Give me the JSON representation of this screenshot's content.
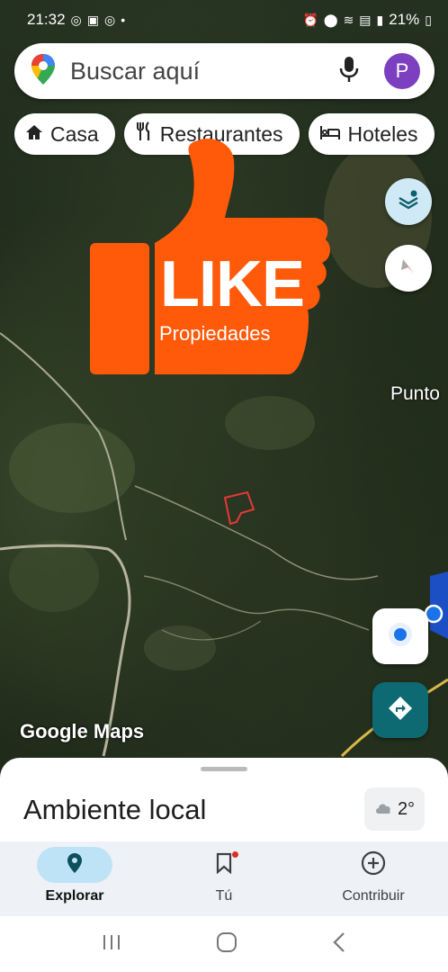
{
  "status": {
    "time": "21:32",
    "battery": "21%"
  },
  "search": {
    "placeholder": "Buscar aquí",
    "avatar_letter": "P"
  },
  "chips": [
    {
      "label": "Casa",
      "icon": "home-icon"
    },
    {
      "label": "Restaurantes",
      "icon": "restaurant-icon"
    },
    {
      "label": "Hoteles",
      "icon": "hotel-icon"
    }
  ],
  "map": {
    "place_label": "Punto",
    "watermark": "Google Maps"
  },
  "overlay_logo": {
    "main": "LIKE",
    "sub": "Propiedades",
    "color": "#ff5a0a"
  },
  "sheet": {
    "title": "Ambiente local",
    "temperature": "2°"
  },
  "bottom_nav": [
    {
      "label": "Explorar",
      "icon": "explore-pin-icon",
      "active": true
    },
    {
      "label": "Tú",
      "icon": "bookmark-icon",
      "active": false
    },
    {
      "label": "Contribuir",
      "icon": "add-circle-icon",
      "active": false
    }
  ],
  "colors": {
    "accent_teal": "#0d6a73",
    "nav_active_bg": "#bfe3f6",
    "avatar": "#7b3fbf"
  }
}
